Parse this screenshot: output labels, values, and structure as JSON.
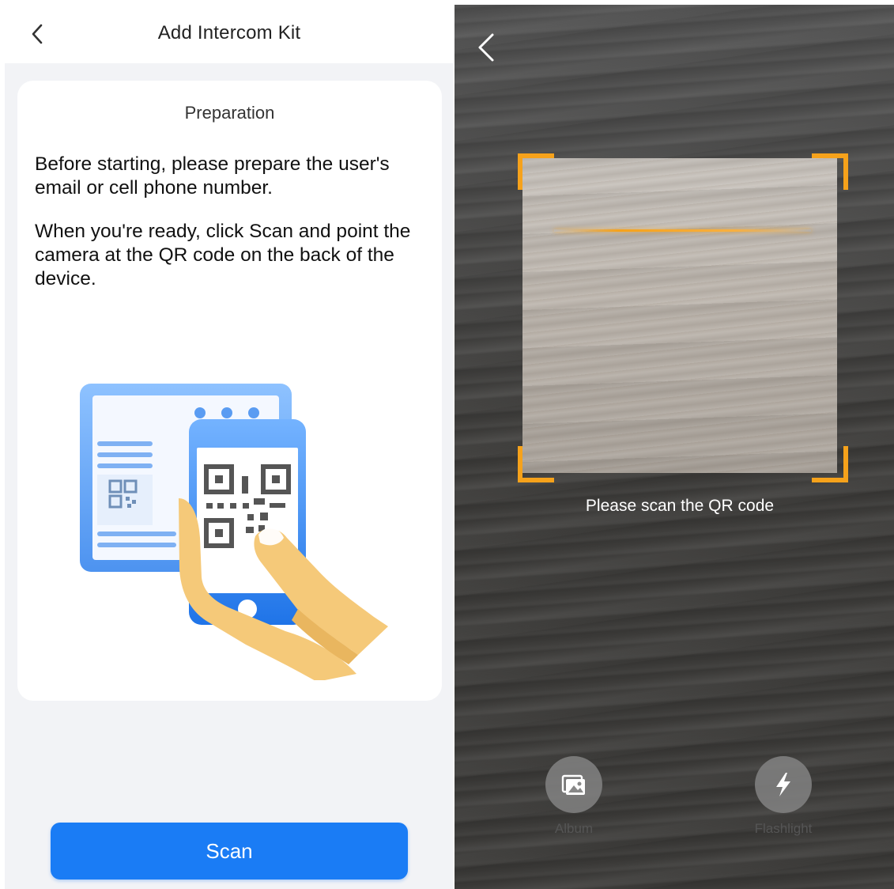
{
  "left": {
    "header": {
      "title": "Add Intercom Kit"
    },
    "card": {
      "heading": "Preparation",
      "paragraph1": "Before starting, please prepare the user's email or cell phone number.",
      "paragraph2": "When you're ready, click Scan and point the camera at the QR code on the back of the device."
    },
    "scan_button": "Scan"
  },
  "right": {
    "hint": "Please scan the QR code",
    "tools": {
      "album": "Album",
      "flashlight": "Flashlight"
    }
  },
  "colors": {
    "primary_blue": "#1a7cf5",
    "scan_orange": "#f6a21b",
    "icon_icons": [
      "back-arrow-icon",
      "qr-scan-illustration",
      "album-icon",
      "flashlight-icon"
    ]
  }
}
